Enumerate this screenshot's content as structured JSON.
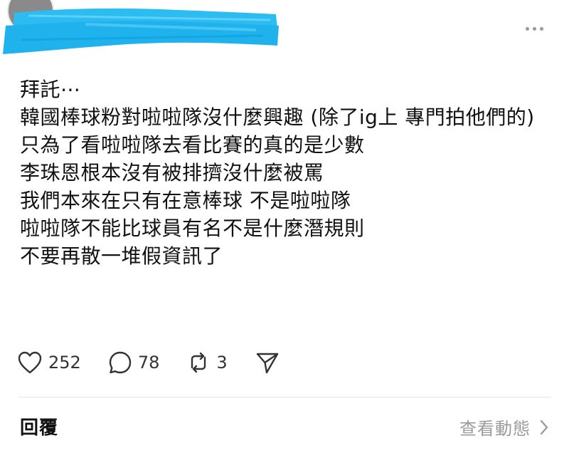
{
  "post": {
    "lines": [
      "拜託⋯",
      "韓國棒球粉對啦啦隊沒什麼興趣 (除了ig上 專門拍他們的)",
      "只為了看啦啦隊去看比賽的真的是少數",
      "李珠恩根本沒有被排擠沒什麼被罵",
      "我們本來在只有在意棒球 不是啦啦隊",
      "啦啦隊不能比球員有名不是什麼潛規則",
      "不要再散一堆假資訊了"
    ]
  },
  "actions": {
    "likes": "252",
    "comments": "78",
    "reposts": "3"
  },
  "footer": {
    "reply_label": "回覆",
    "activity_label": "查看動態"
  },
  "colors": {
    "redaction": "#2bbcf2",
    "muted_text": "#9b9b9b",
    "icon": "#333333"
  },
  "icons": [
    "more-icon",
    "heart-icon",
    "comment-icon",
    "repost-icon",
    "share-icon",
    "chevron-right-icon"
  ]
}
